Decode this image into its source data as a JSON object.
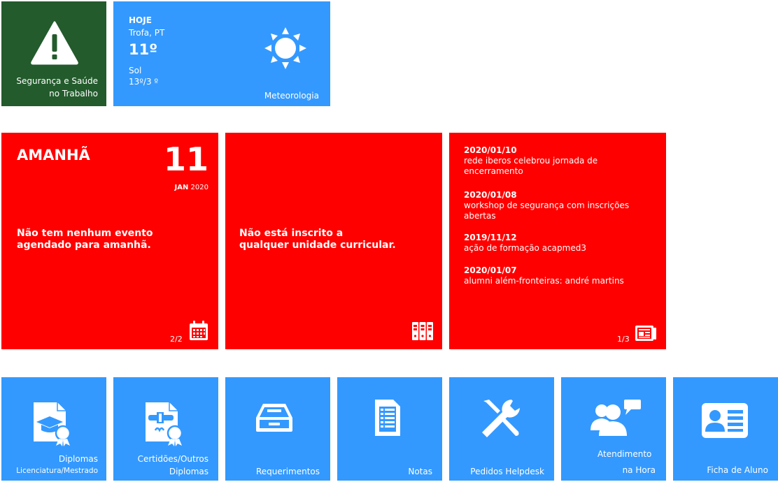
{
  "row1": {
    "safety": {
      "label_line1": "Segurança e Saúde",
      "label_line2": "no Trabalho",
      "icon": "warning-triangle-icon"
    },
    "weather": {
      "day": "HOJE",
      "location": "Trofa, PT",
      "temp": "11º",
      "condition": "Sol",
      "range": "13º/3 º",
      "label": "Meteorologia",
      "icon": "sun-icon"
    }
  },
  "row2": {
    "agenda": {
      "title": "AMANHÃ",
      "day_number": "11",
      "month": "JAN",
      "year": "2020",
      "message_line1": "Não tem nenhum evento",
      "message_line2": "agendado para amanhã.",
      "pager": "2/2",
      "icon": "calendar-icon"
    },
    "courses": {
      "message_line1": "Não está inscrito a",
      "message_line2": "qualquer unidade curricular.",
      "icon": "binders-icon"
    },
    "news": {
      "items": [
        {
          "date": "2020/01/10",
          "line1": "rede iberos celebrou jornada de",
          "line2": "encerramento"
        },
        {
          "date": "2020/01/08",
          "line1": "workshop de segurança com inscrições",
          "line2": "abertas"
        },
        {
          "date": "2019/11/12",
          "line1": "ação de formação acapmed3",
          "line2": ""
        },
        {
          "date": "2020/01/07",
          "line1": "alumni além-fronteiras: andré martins",
          "line2": ""
        }
      ],
      "pager": "1/3",
      "icon": "newspaper-icon"
    }
  },
  "row3": [
    {
      "line1": "Diplomas",
      "line2": "Licenciatura/Mestrado",
      "icon": "diploma-certificate-icon"
    },
    {
      "line1": "Certidões/Outros",
      "line2": "Diplomas",
      "icon": "certificate-document-icon"
    },
    {
      "line1": "Requerimentos",
      "line2": "",
      "icon": "inbox-tray-icon"
    },
    {
      "line1": "Notas",
      "line2": "",
      "icon": "document-list-icon"
    },
    {
      "line1": "Pedidos Helpdesk",
      "line2": "",
      "icon": "tools-icon"
    },
    {
      "line1": "Atendimento",
      "line2": "na Hora",
      "icon": "people-chat-icon"
    },
    {
      "line1": "Ficha de Aluno",
      "line2": "",
      "icon": "id-card-icon"
    }
  ],
  "colors": {
    "green": "#235b2c",
    "blue": "#3399ff",
    "red": "#ff0000"
  }
}
